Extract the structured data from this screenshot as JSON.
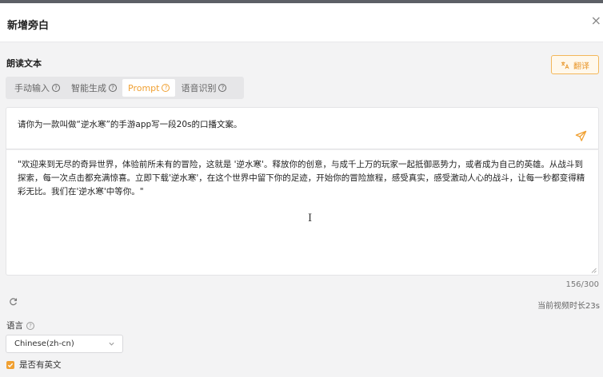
{
  "dialog": {
    "title": "新增旁白",
    "close_glyph": "×"
  },
  "section": {
    "label": "朗读文本"
  },
  "translate": {
    "label": "翻译",
    "icon": "translate-icon"
  },
  "tabs": [
    {
      "label": "手动输入",
      "active": false
    },
    {
      "label": "智能生成",
      "active": false
    },
    {
      "label": "Prompt",
      "active": true
    },
    {
      "label": "语音识别",
      "active": false
    }
  ],
  "prompt": {
    "text": "请你为一款叫做“逆水寒”的手游app写一段20s的口播文案。",
    "send_icon": "send-icon"
  },
  "output": {
    "text": "\"欢迎来到无尽的奇异世界，体验前所未有的冒险，这就是 '逆水寒'。释放你的创意，与成千上万的玩家一起抵御恶势力，或者成为自己的英雄。从战斗到探索，每一次点击都充满惊喜。立即下载'逆水寒'，在这个世界中留下你的足迹，开始你的冒险旅程，感受真实，感受激动人心的战斗，让每一秒都变得精彩无比。我们在'逆水寒'中等你。\""
  },
  "counter": {
    "text": "156/300"
  },
  "video": {
    "duration_text": "当前视频时长23s"
  },
  "language": {
    "label": "语言",
    "selected": "Chinese(zh-cn)"
  },
  "english_option": {
    "label": "是否有英文",
    "checked": true
  },
  "colors": {
    "accent": "#f0a032",
    "accent_border": "#f3b75a",
    "background": "#f3f3f4"
  }
}
